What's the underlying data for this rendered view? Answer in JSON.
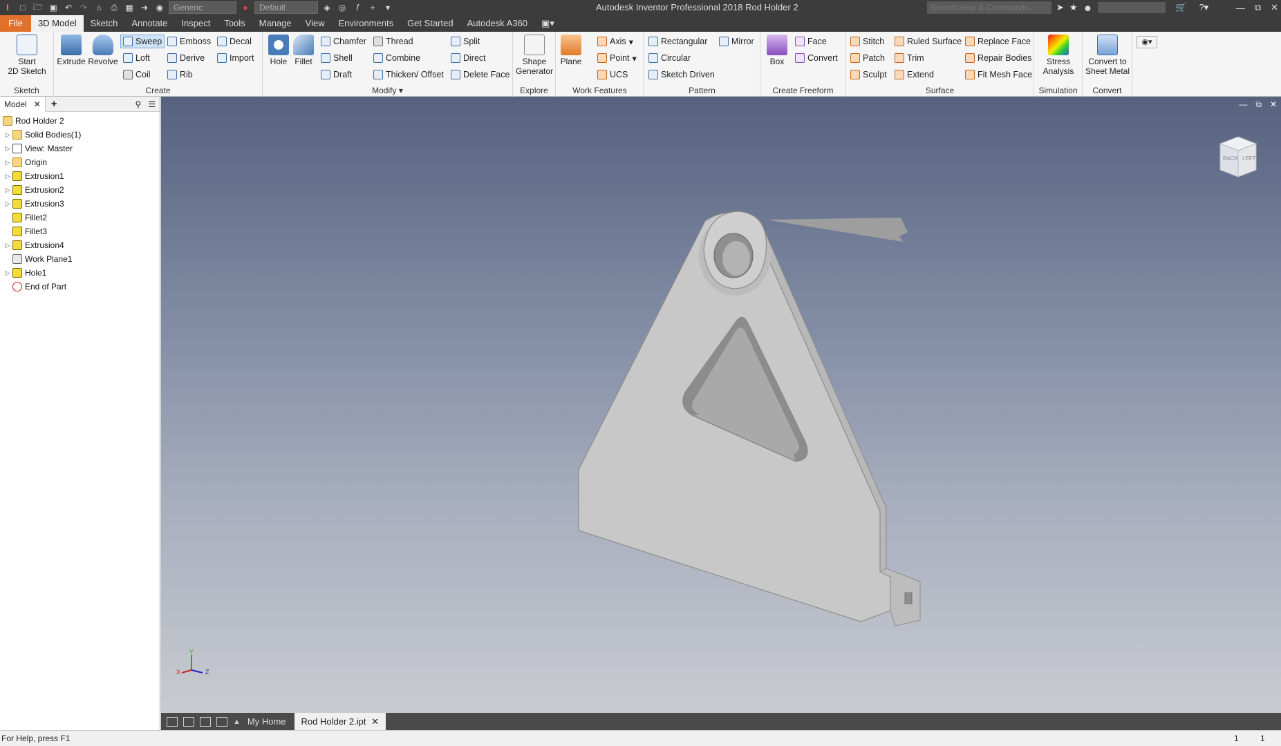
{
  "app": {
    "title": "Autodesk Inventor Professional 2018   Rod Holder 2",
    "search_placeholder": "Search Help & Commands...",
    "material_dropdown": "Generic",
    "appearance_dropdown": "Default"
  },
  "menu": {
    "file": "File",
    "tabs": [
      "3D Model",
      "Sketch",
      "Annotate",
      "Inspect",
      "Tools",
      "Manage",
      "View",
      "Environments",
      "Get Started",
      "Autodesk A360"
    ]
  },
  "ribbon": {
    "sketch": {
      "start_line1": "Start",
      "start_line2": "2D Sketch",
      "label": "Sketch"
    },
    "create": {
      "extrude": "Extrude",
      "revolve": "Revolve",
      "sweep": "Sweep",
      "emboss": "Emboss",
      "decal": "Decal",
      "loft": "Loft",
      "derive": "Derive",
      "import": "Import",
      "coil": "Coil",
      "rib": "Rib",
      "label": "Create"
    },
    "modify": {
      "hole": "Hole",
      "fillet": "Fillet",
      "chamfer": "Chamfer",
      "thread": "Thread",
      "split": "Split",
      "shell": "Shell",
      "combine": "Combine",
      "direct": "Direct",
      "draft": "Draft",
      "thicken": "Thicken/ Offset",
      "delete_face": "Delete Face",
      "label": "Modify"
    },
    "explore": {
      "shape_line1": "Shape",
      "shape_line2": "Generator",
      "label": "Explore"
    },
    "work": {
      "plane": "Plane",
      "axis": "Axis",
      "point": "Point",
      "ucs": "UCS",
      "label": "Work Features"
    },
    "pattern": {
      "rectangular": "Rectangular",
      "mirror": "Mirror",
      "circular": "Circular",
      "sketch_driven": "Sketch Driven",
      "label": "Pattern"
    },
    "freeform": {
      "box": "Box",
      "face": "Face",
      "convert": "Convert",
      "label": "Create Freeform"
    },
    "surface": {
      "stitch": "Stitch",
      "ruled": "Ruled Surface",
      "replace": "Replace Face",
      "patch": "Patch",
      "trim": "Trim",
      "repair": "Repair Bodies",
      "sculpt": "Sculpt",
      "extend": "Extend",
      "fitmesh": "Fit Mesh Face",
      "label": "Surface"
    },
    "simulation": {
      "stress_line1": "Stress",
      "stress_line2": "Analysis",
      "label": "Simulation"
    },
    "convert": {
      "sheet_line1": "Convert to",
      "sheet_line2": "Sheet Metal",
      "label": "Convert"
    }
  },
  "browser": {
    "tab": "Model",
    "root": "Rod Holder 2",
    "items": [
      "Solid Bodies(1)",
      "View: Master",
      "Origin",
      "Extrusion1",
      "Extrusion2",
      "Extrusion3",
      "Fillet2",
      "Fillet3",
      "Extrusion4",
      "Work Plane1",
      "Hole1",
      "End of Part"
    ]
  },
  "viewcube": {
    "face1": "BACK",
    "face2": "LEFT"
  },
  "doctabs": {
    "home": "My Home",
    "active": "Rod Holder 2.ipt"
  },
  "status": {
    "help": "For Help, press F1",
    "count1": "1",
    "count2": "1"
  }
}
